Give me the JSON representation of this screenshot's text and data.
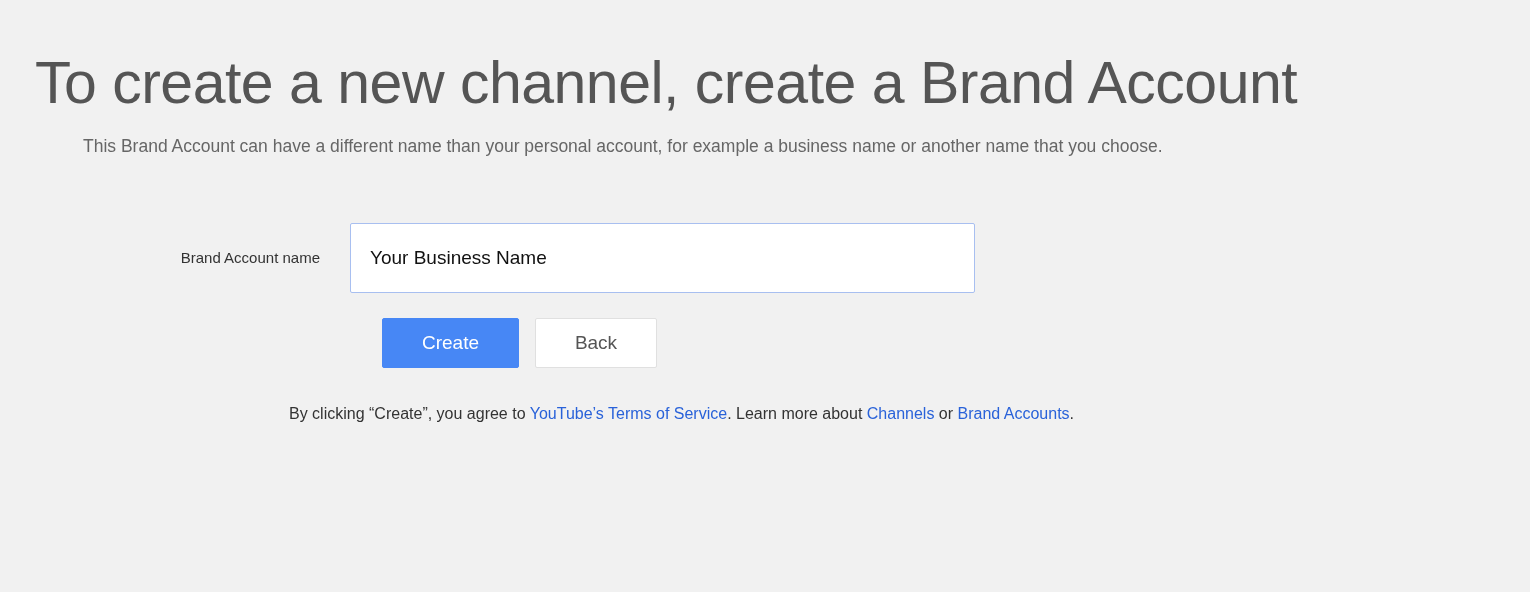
{
  "heading": "To create a new channel, create a Brand Account",
  "subtitle": "This Brand Account can have a different name than your personal account, for example a business name or another name that you choose.",
  "name_field": {
    "label": "Brand Account name",
    "value": "Your Business Name"
  },
  "buttons": [
    {
      "label": "Create",
      "kind": "primary"
    },
    {
      "label": "Back",
      "kind": "secondary"
    }
  ],
  "terms": [
    {
      "kind": "text",
      "text": "By clicking “Create”, you agree to "
    },
    {
      "kind": "link",
      "text": "YouTube’s Terms of Service"
    },
    {
      "kind": "text",
      "text": ". Learn more about "
    },
    {
      "kind": "link",
      "text": "Channels"
    },
    {
      "kind": "text",
      "text": " or "
    },
    {
      "kind": "link",
      "text": "Brand Accounts"
    },
    {
      "kind": "text",
      "text": "."
    }
  ]
}
